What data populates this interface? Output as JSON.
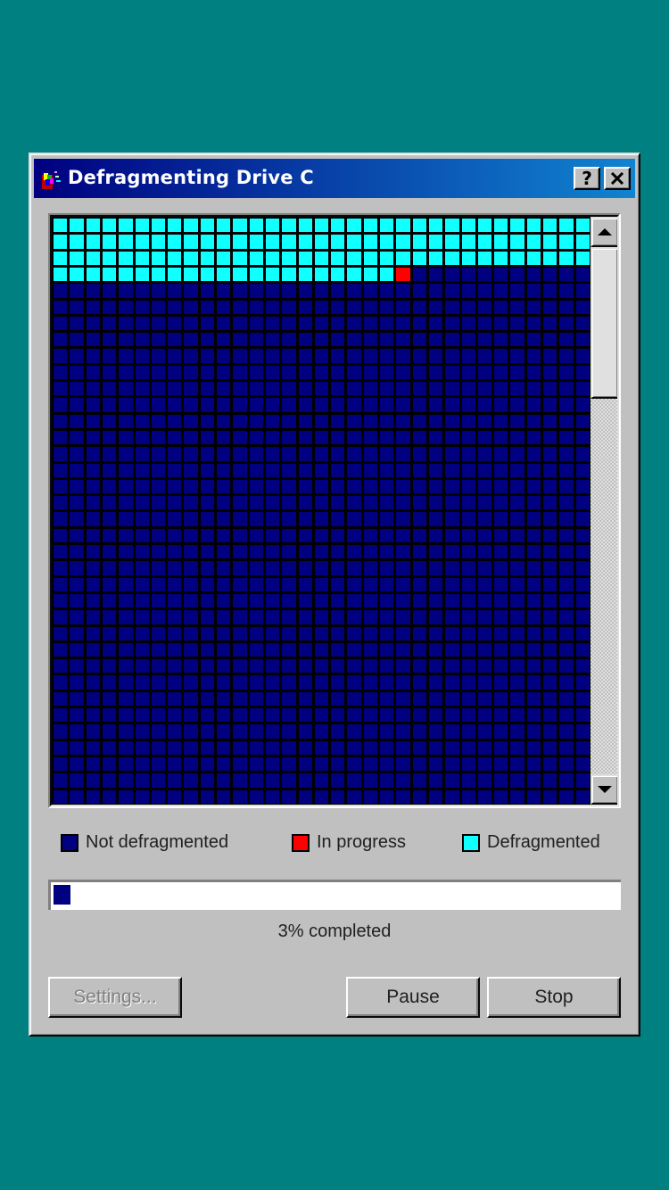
{
  "window": {
    "title": "Defragmenting Drive C",
    "help_label": "?",
    "close_label": "✕",
    "app_icon": "defrag-icon"
  },
  "cluster_map": {
    "columns": 33,
    "rows": 36,
    "defragmented_cells": 120,
    "in_progress_cells": [
      120
    ],
    "colors": {
      "not_defragmented": "#000080",
      "in_progress": "#ff0000",
      "defragmented": "#10ffff",
      "gridline": "#000000"
    }
  },
  "scrollbar": {
    "up_icon": "arrow-up-icon",
    "down_icon": "arrow-down-icon",
    "position": 0
  },
  "legend": [
    {
      "label": "Not defragmented",
      "color": "#000080"
    },
    {
      "label": "In progress",
      "color": "#ff0000"
    },
    {
      "label": "Defragmented",
      "color": "#10ffff"
    }
  ],
  "progress": {
    "percent": 3,
    "text": "3% completed",
    "color": "#000080"
  },
  "buttons": {
    "settings": "Settings...",
    "pause": "Pause",
    "stop": "Stop"
  }
}
